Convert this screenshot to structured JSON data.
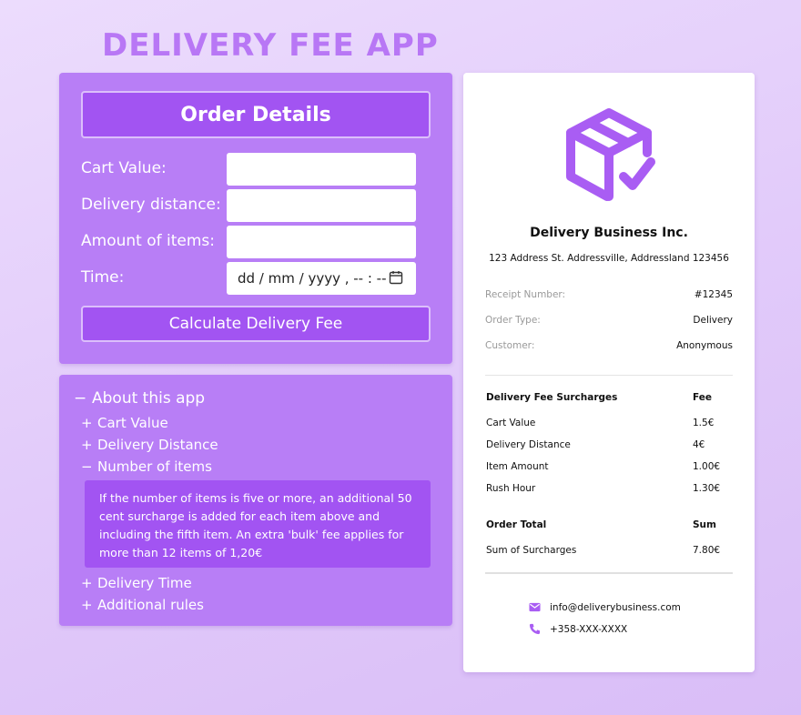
{
  "app_title": "DELIVERY FEE APP",
  "order_form": {
    "header": "Order Details",
    "cart_value_label": "Cart Value:",
    "cart_value_value": "",
    "distance_label": "Delivery distance:",
    "distance_value": "",
    "items_label": "Amount of items:",
    "items_value": "",
    "time_label": "Time:",
    "time_placeholder": "dd / mm / yyyy ,  -- : --",
    "calculate_button": "Calculate Delivery Fee"
  },
  "about": {
    "title": "About this app",
    "items": [
      {
        "sign": "+",
        "label": "Cart Value"
      },
      {
        "sign": "+",
        "label": "Delivery Distance"
      },
      {
        "sign": "−",
        "label": "Number of items",
        "body": "If the number of items is five or more, an additional 50 cent surcharge is added for each item above and including the fifth item. An extra 'bulk' fee applies for more than 12 items of 1,20€"
      },
      {
        "sign": "+",
        "label": "Delivery Time"
      },
      {
        "sign": "+",
        "label": "Additional rules"
      }
    ]
  },
  "receipt": {
    "logo_icon": "package-check-icon",
    "business_name": "Delivery Business Inc.",
    "address": "123 Address St. Addressville, Addressland 123456",
    "meta": [
      {
        "key": "Receipt Number:",
        "value": "#12345"
      },
      {
        "key": "Order Type:",
        "value": "Delivery"
      },
      {
        "key": "Customer:",
        "value": "Anonymous"
      }
    ],
    "surcharge_header": {
      "c1": "Delivery Fee Surcharges",
      "c2": "Fee"
    },
    "surcharges": [
      {
        "name": "Cart Value",
        "fee": "1.5€"
      },
      {
        "name": "Delivery Distance",
        "fee": "4€"
      },
      {
        "name": "Item Amount",
        "fee": "1.00€"
      },
      {
        "name": "Rush Hour",
        "fee": "1.30€"
      }
    ],
    "total_header": {
      "c1": "Order Total",
      "c2": "Sum"
    },
    "total_row": {
      "name": "Sum of Surcharges",
      "value": "7.80€"
    },
    "email": "info@deliverybusiness.com",
    "phone": "+358-XXX-XXXX"
  },
  "colors": {
    "accent": "#b877f5",
    "panel": "#b87ef6",
    "button": "#a254f2",
    "icon": "#a95df3"
  }
}
